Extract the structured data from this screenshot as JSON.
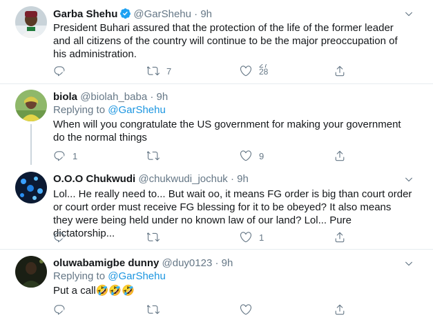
{
  "tweets": [
    {
      "name": "Garba Shehu",
      "verified": true,
      "handle": "@GarShehu",
      "sep": "·",
      "time": "9h",
      "text": "President Buhari assured that the protection of the life of the former leader and all citizens of the country will continue to be the major preoccupation of his administration.",
      "reply_count": "",
      "retweet_count": "7",
      "like_count_top": "27",
      "like_count_bottom": "28"
    },
    {
      "name": "biola",
      "handle": "@biolah_baba",
      "sep": "·",
      "time": "9h",
      "replying_prefix": "Replying to",
      "replying_to": "@GarShehu",
      "text": "When will you congratulate the US government for making your government do the normal things",
      "reply_count": "1",
      "retweet_count": "",
      "like_count": "9"
    },
    {
      "name": "O.O.O Chukwudi",
      "handle": "@chukwudi_jochuk",
      "sep": "·",
      "time": "9h",
      "text": "Lol... He really need to... But wait oo, it means FG order is big than court order or court order must receive FG blessing for it to be obeyed? It also means they were being held under no known law of our land? Lol... Pure dictatorship...",
      "reply_count": "",
      "retweet_count": "",
      "like_count": "1"
    },
    {
      "name": "oluwabamigbe dunny",
      "handle": "@duy0123",
      "sep": "·",
      "time": "9h",
      "replying_prefix": "Replying to",
      "replying_to": "@GarShehu",
      "text": "Put a call🤣🤣🤣",
      "reply_count": "",
      "retweet_count": "",
      "like_count": ""
    }
  ],
  "icons": {
    "reply": "reply-icon",
    "retweet": "retweet-icon",
    "like": "heart-icon",
    "share": "share-icon",
    "caret": "chevron-down-icon",
    "verified": "verified-badge-icon"
  },
  "colors": {
    "text": "#14171a",
    "muted": "#657786",
    "link": "#1b95e0",
    "divider": "#e6ecf0",
    "verified": "#1da1f2"
  }
}
